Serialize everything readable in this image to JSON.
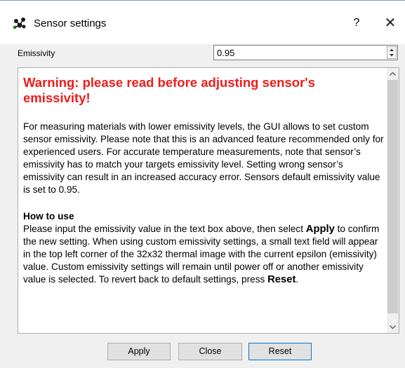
{
  "window": {
    "title": "Sensor settings",
    "help_label": "?",
    "close_label": "✕"
  },
  "emissivity": {
    "label": "Emissivity",
    "value": "0.95"
  },
  "content": {
    "warning_title": "Warning: please read before adjusting sensor's emissivity!",
    "paragraph_1": "For measuring materials with lower emissivity levels, the GUI allows to set custom sensor emissivity. Please note that this is an advanced feature recommended only for experienced users. For accurate temperature measurements, note that sensor’s emissivity has to match your targets emissivity level. Setting wrong sensor’s emissivity can result in an increased accuracy error. Sensors default emissivity value is set to 0.95.",
    "howto_heading": "How to use",
    "howto_part1": "Please input the emissivity value in the text box above, then select ",
    "howto_apply": "Apply",
    "howto_part2": " to confirm the new setting. When using custom emissivity settings, a small text field will appear in the top left corner of the 32x32 thermal image with the current epsilon (emissivity) value. Custom emissivity settings will remain until power off or another emissivity value is selected. To revert back to default settings, press ",
    "howto_reset": "Reset",
    "howto_part3": "."
  },
  "buttons": {
    "apply": "Apply",
    "close": "Close",
    "reset": "Reset"
  },
  "colors": {
    "warning": "#ee1c1c",
    "focus_border": "#0078d7"
  },
  "icons": {
    "app": "sensor-app-icon",
    "scroll_up": "chevron-up-icon",
    "scroll_down": "chevron-down-icon"
  }
}
